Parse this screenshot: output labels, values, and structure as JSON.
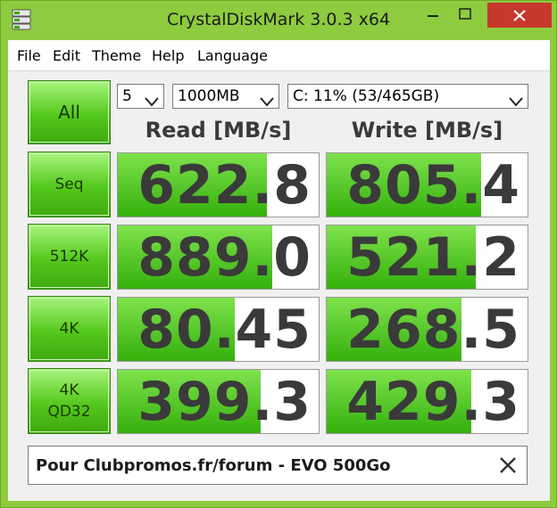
{
  "window": {
    "title": "CrystalDiskMark 3.0.3 x64",
    "accent_color": "#8ecb3f",
    "controls": [
      "minimize-icon",
      "maximize-icon",
      "close-icon"
    ]
  },
  "menu": {
    "items": [
      "File",
      "Edit",
      "Theme",
      "Help",
      "Language"
    ]
  },
  "controls": {
    "all_label": "All",
    "test_count": "5",
    "test_size": "1000MB",
    "drive": "C: 11% (53/465GB)"
  },
  "headers": {
    "read": "Read [MB/s]",
    "write": "Write [MB/s]"
  },
  "tests": [
    {
      "label": "Seq",
      "read": "622.8",
      "write": "805.4",
      "read_fill": 0.74,
      "write_fill": 0.77
    },
    {
      "label": "512K",
      "read": "889.0",
      "write": "521.2",
      "read_fill": 0.77,
      "write_fill": 0.74
    },
    {
      "label": "4K",
      "read": "80.45",
      "write": "268.5",
      "read_fill": 0.58,
      "write_fill": 0.67
    },
    {
      "label_line1": "4K",
      "label_line2": "QD32",
      "read": "399.3",
      "write": "429.3",
      "read_fill": 0.71,
      "write_fill": 0.72
    }
  ],
  "comment": {
    "text": "Pour Clubpromos.fr/forum - EVO 500Go"
  }
}
